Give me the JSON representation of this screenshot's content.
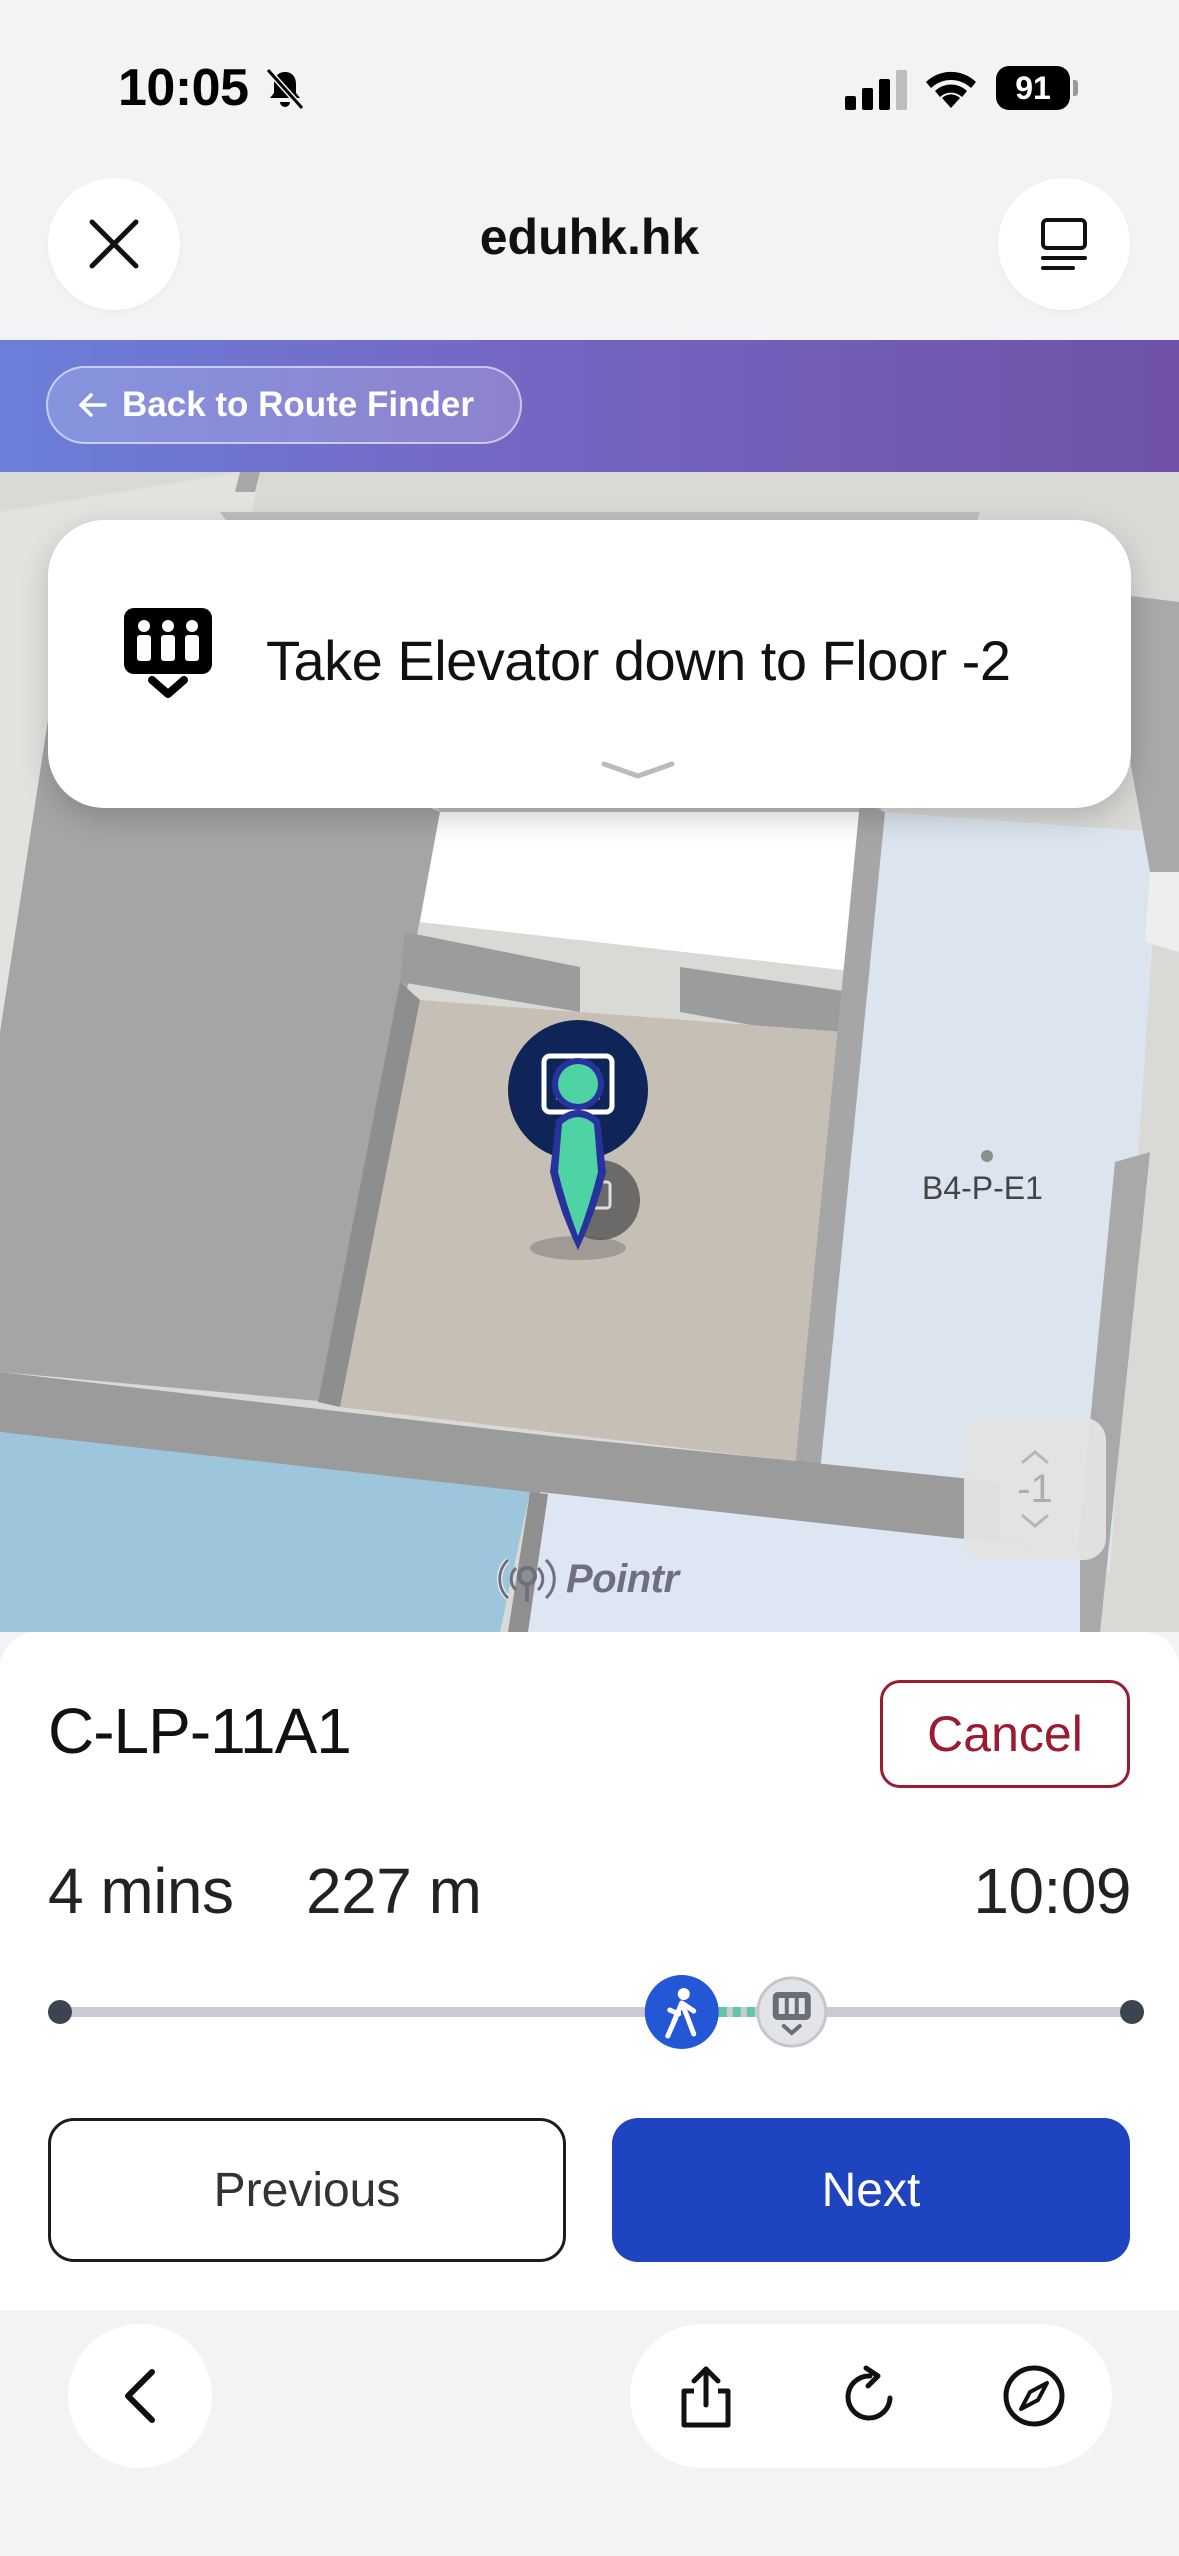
{
  "status_bar": {
    "time": "10:05",
    "battery": "91"
  },
  "browser": {
    "site_title": "eduhk.hk"
  },
  "banner": {
    "back_label": "Back to Route Finder"
  },
  "instruction": {
    "text": "Take Elevator down to Floor -2"
  },
  "map": {
    "room_label": "B4-P-E1",
    "floor_level": "-1",
    "brand": "Pointr"
  },
  "route": {
    "destination": "C-LP-11A1",
    "cancel_label": "Cancel",
    "duration": "4 mins",
    "distance": "227 m",
    "arrival_time": "10:09",
    "progress_fraction": 0.58
  },
  "controls": {
    "previous_label": "Previous",
    "next_label": "Next"
  },
  "colors": {
    "accent": "#1f44bf",
    "cancel": "#9b1b30",
    "banner_start": "#6b7fd9",
    "banner_end": "#7052a8"
  }
}
